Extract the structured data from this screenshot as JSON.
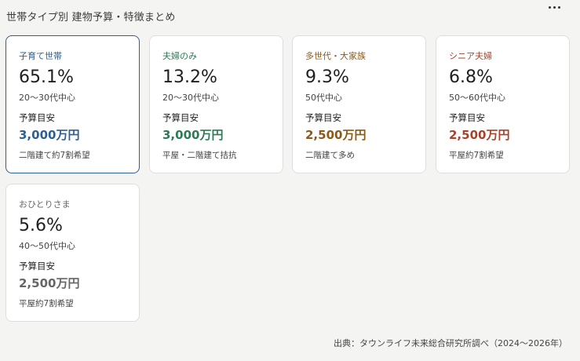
{
  "header": {
    "title": "世帯タイプ別 建物予算・特徴まとめ",
    "menu_icon": "more-horizontal-icon"
  },
  "budget_label": "予算目安",
  "cards": [
    {
      "label": "子育て世帯",
      "percent": "65.1%",
      "age": "20〜30代中心",
      "budget": "3,000万円",
      "note": "二階建て約7割希望",
      "accent": "#2d5f8f",
      "selected": true
    },
    {
      "label": "夫婦のみ",
      "percent": "13.2%",
      "age": "20〜30代中心",
      "budget": "3,000万円",
      "note": "平屋・二階建て拮抗",
      "accent": "#2e7a54",
      "selected": false
    },
    {
      "label": "多世代・大家族",
      "percent": "9.3%",
      "age": "50代中心",
      "budget": "2,500万円",
      "note": "二階建て多め",
      "accent": "#8a5a16",
      "selected": false
    },
    {
      "label": "シニア夫婦",
      "percent": "6.8%",
      "age": "50〜60代中心",
      "budget": "2,500万円",
      "note": "平屋約7割希望",
      "accent": "#a5432b",
      "selected": false
    },
    {
      "label": "おひとりさま",
      "percent": "5.6%",
      "age": "40〜50代中心",
      "budget": "2,500万円",
      "note": "平屋約7割希望",
      "accent": "#666666",
      "selected": false
    }
  ],
  "source": "出典：タウンライフ未来総合研究所調べ（2024〜2026年）"
}
